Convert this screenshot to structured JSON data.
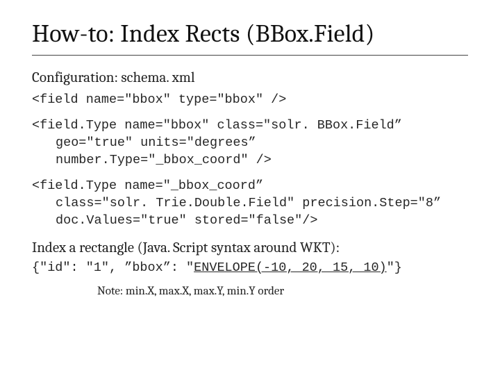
{
  "title": "How-to: Index Rects (BBox.Field)",
  "config_label": "Configuration: schema. xml",
  "code_field": "<field name=\"bbox\" type=\"bbox\" />",
  "code_fieldtype1_l1": "<field.Type name=\"bbox\" class=\"solr. BBox.Field”",
  "code_fieldtype1_l2": "geo=\"true\" units=\"degrees”",
  "code_fieldtype1_l3": "number.Type=\"_bbox_coord\" />",
  "code_fieldtype2_l1": "<field.Type name=\"_bbox_coord”",
  "code_fieldtype2_l2": "class=\"solr. Trie.Double.Field\" precision.Step=\"8”",
  "code_fieldtype2_l3": "doc.Values=\"true\" stored=\"false\"/>",
  "index_label": "Index a rectangle (Java. Script syntax around WKT):",
  "wkt_pre": "{\"id\": \"1\", ”bbox”: \"",
  "wkt_env": "ENVELOPE(-10, 20, 15, 10)",
  "wkt_post": "\"}",
  "note": "Note: min.X, max.X, max.Y, min.Y order"
}
